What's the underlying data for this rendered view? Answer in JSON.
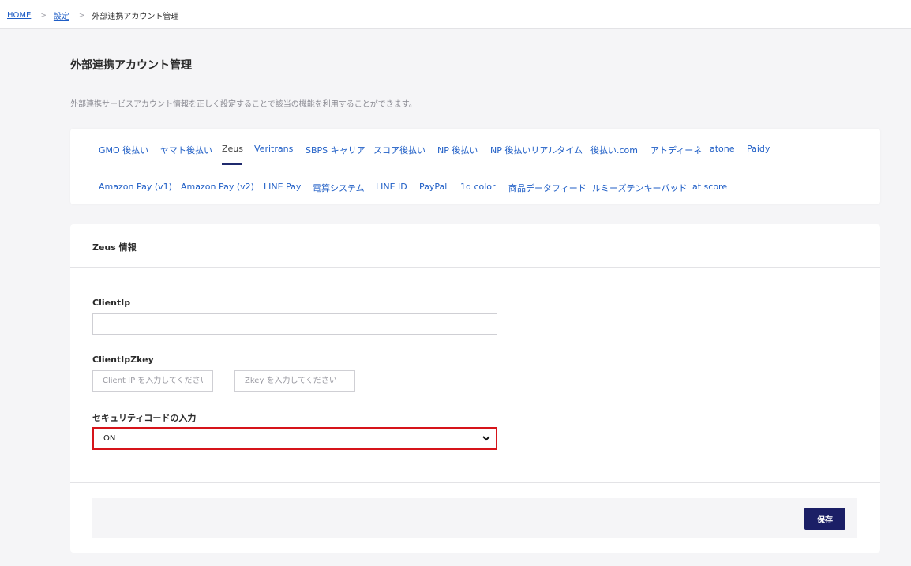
{
  "breadcrumb": {
    "home": "HOME",
    "settings": "設定",
    "current": "外部連携アカウント管理",
    "separator": ">"
  },
  "page": {
    "title": "外部連携アカウント管理",
    "description": "外部連携サービスアカウント情報を正しく設定することで該当の機能を利用することができます。"
  },
  "tabs": {
    "row1": [
      "GMO 後払い",
      "ヤマト後払い",
      "Zeus",
      "Veritrans",
      "SBPS キャリア",
      "スコア後払い",
      "NP 後払い",
      "NP 後払いリアルタイム",
      "後払い.com",
      "アトディーネ",
      "atone",
      "Paidy"
    ],
    "row2": [
      "Amazon Pay (v1)",
      "Amazon Pay (v2)",
      "LINE Pay",
      "電算システム",
      "LINE ID",
      "PayPal",
      "1d color",
      "商品データフィード",
      "ルミーズテンキーパッド",
      "at score"
    ],
    "active": "Zeus"
  },
  "card": {
    "title": "Zeus 情報"
  },
  "fields": {
    "client_ip_label": "ClientIp",
    "client_ip_value": "",
    "client_ip_zkey_label": "ClientIpZkey",
    "client_ip_placeholder": "Client IP を入力してください",
    "zkey_placeholder": "Zkey を入力してください",
    "security_code_label": "セキュリティコードの入力",
    "security_code_value": "ON"
  },
  "footer": {
    "save_label": "保存"
  },
  "colors": {
    "link": "#1f5ec6",
    "primary_button": "#1b1f66",
    "highlight_border": "#d6141a"
  }
}
